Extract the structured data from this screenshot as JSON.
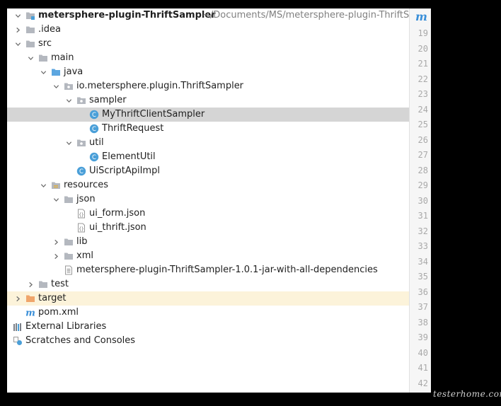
{
  "tree": {
    "root": {
      "name": "metersphere-plugin-ThriftSampler",
      "path": "~/Documents/MS/metersphere-plugin-ThriftSampler"
    },
    "items": [
      {
        "label": "metersphere-plugin-ThriftSampler",
        "depth": 0,
        "arrow": "down",
        "icon": "module-folder-icon",
        "root": true
      },
      {
        "label": ".idea",
        "depth": 0,
        "arrow": "right",
        "icon": "folder-icon"
      },
      {
        "label": "src",
        "depth": 0,
        "arrow": "down",
        "icon": "folder-icon"
      },
      {
        "label": "main",
        "depth": 1,
        "arrow": "down",
        "icon": "folder-icon"
      },
      {
        "label": "java",
        "depth": 2,
        "arrow": "down",
        "icon": "source-folder-icon"
      },
      {
        "label": "io.metersphere.plugin.ThriftSampler",
        "depth": 3,
        "arrow": "down",
        "icon": "package-icon"
      },
      {
        "label": "sampler",
        "depth": 4,
        "arrow": "down",
        "icon": "package-icon"
      },
      {
        "label": "MyThriftClientSampler",
        "depth": 5,
        "arrow": "none",
        "icon": "class-icon",
        "selected": true
      },
      {
        "label": "ThriftRequest",
        "depth": 5,
        "arrow": "none",
        "icon": "class-icon"
      },
      {
        "label": "util",
        "depth": 4,
        "arrow": "down",
        "icon": "package-icon"
      },
      {
        "label": "ElementUtil",
        "depth": 5,
        "arrow": "none",
        "icon": "class-icon"
      },
      {
        "label": "UiScriptApiImpl",
        "depth": 4,
        "arrow": "none",
        "icon": "class-icon"
      },
      {
        "label": "resources",
        "depth": 2,
        "arrow": "down",
        "icon": "resources-folder-icon"
      },
      {
        "label": "json",
        "depth": 3,
        "arrow": "down",
        "icon": "folder-icon"
      },
      {
        "label": "ui_form.json",
        "depth": 4,
        "arrow": "none",
        "icon": "json-file-icon"
      },
      {
        "label": "ui_thrift.json",
        "depth": 4,
        "arrow": "none",
        "icon": "json-file-icon"
      },
      {
        "label": "lib",
        "depth": 3,
        "arrow": "right",
        "icon": "folder-icon"
      },
      {
        "label": "xml",
        "depth": 3,
        "arrow": "right",
        "icon": "folder-icon"
      },
      {
        "label": "metersphere-plugin-ThriftSampler-1.0.1-jar-with-all-dependencies",
        "depth": 3,
        "arrow": "none",
        "icon": "text-file-icon"
      },
      {
        "label": "test",
        "depth": 1,
        "arrow": "right",
        "icon": "folder-icon"
      },
      {
        "label": "target",
        "depth": 0,
        "arrow": "right",
        "icon": "excluded-folder-icon",
        "highlighted": true
      },
      {
        "label": "pom.xml",
        "depth": 0,
        "arrow": "none",
        "icon": "maven-icon"
      },
      {
        "label": "External Libraries",
        "depth": -1,
        "arrow": "right",
        "icon": "libraries-icon"
      },
      {
        "label": "Scratches and Consoles",
        "depth": -1,
        "arrow": "right",
        "icon": "scratches-icon"
      }
    ]
  },
  "gutter": {
    "tab_icon": "m",
    "line_numbers": [
      "19",
      "20",
      "21",
      "22",
      "23",
      "24",
      "25",
      "26",
      "27",
      "28",
      "29",
      "30",
      "31",
      "32",
      "33",
      "34",
      "35",
      "36",
      "37",
      "38",
      "39",
      "40",
      "41",
      "42"
    ]
  },
  "watermark": "testerhome.com",
  "colors": {
    "selected": "#d5d5d5",
    "highlighted": "#fcf3da",
    "class_icon": "#4a9fd8",
    "folder": "#b4b8bf",
    "excluded_folder": "#f0a56b"
  }
}
